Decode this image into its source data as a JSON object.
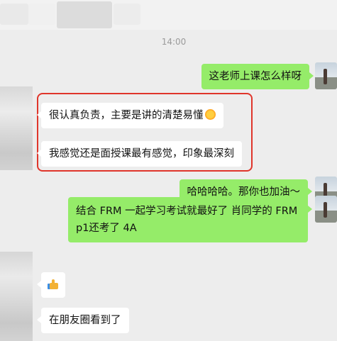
{
  "header": {
    "title_blurred": true
  },
  "timestamp": "14:00",
  "messages": {
    "m1": "这老师上课怎么样呀",
    "m2": "很认真负责，主要是讲的清楚易懂",
    "m2_emoji": "sun-icon",
    "m3": "我感觉还是面授课最有感觉，印象最深刻",
    "m4": "哈哈哈哈。那你也加油～",
    "m5": "结合 FRM 一起学习考试就最好了  肖同学的 FRM p1还考了 4A",
    "m6_emoji": "thumbs-up-icon",
    "m7": "在朋友圈看到了"
  },
  "colors": {
    "background": "#ededed",
    "outgoing_bubble": "#95ec69",
    "incoming_bubble": "#ffffff",
    "highlight_border": "#e0352b"
  }
}
